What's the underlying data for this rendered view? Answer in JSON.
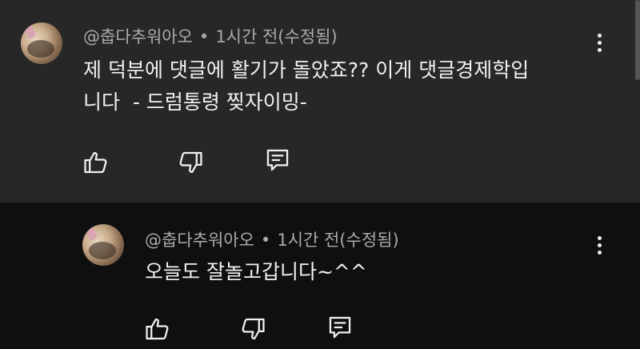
{
  "comment": {
    "author": "@춥다추워아오",
    "separator": "•",
    "time": "1시간 전(수정됨)",
    "text": "제 덕분에 댓글에 활기가 돌았죠?? 이게 댓글경제학입\n니다  - 드럼통령 찢자이밍-"
  },
  "reply": {
    "author": "@춥다추워아오",
    "separator": "•",
    "time": "1시간 전(수정됨)",
    "text": "오늘도 잘놀고갑니다~^^"
  },
  "icons": {
    "like": "thumbs-up-icon",
    "dislike": "thumbs-down-icon",
    "reply": "comment-icon",
    "more": "more-vertical-icon"
  },
  "colors": {
    "highlight_bg": "#272727",
    "page_bg": "#0f0f0f",
    "meta_text": "#aaaaaa",
    "primary_text": "#f1f1f1"
  }
}
